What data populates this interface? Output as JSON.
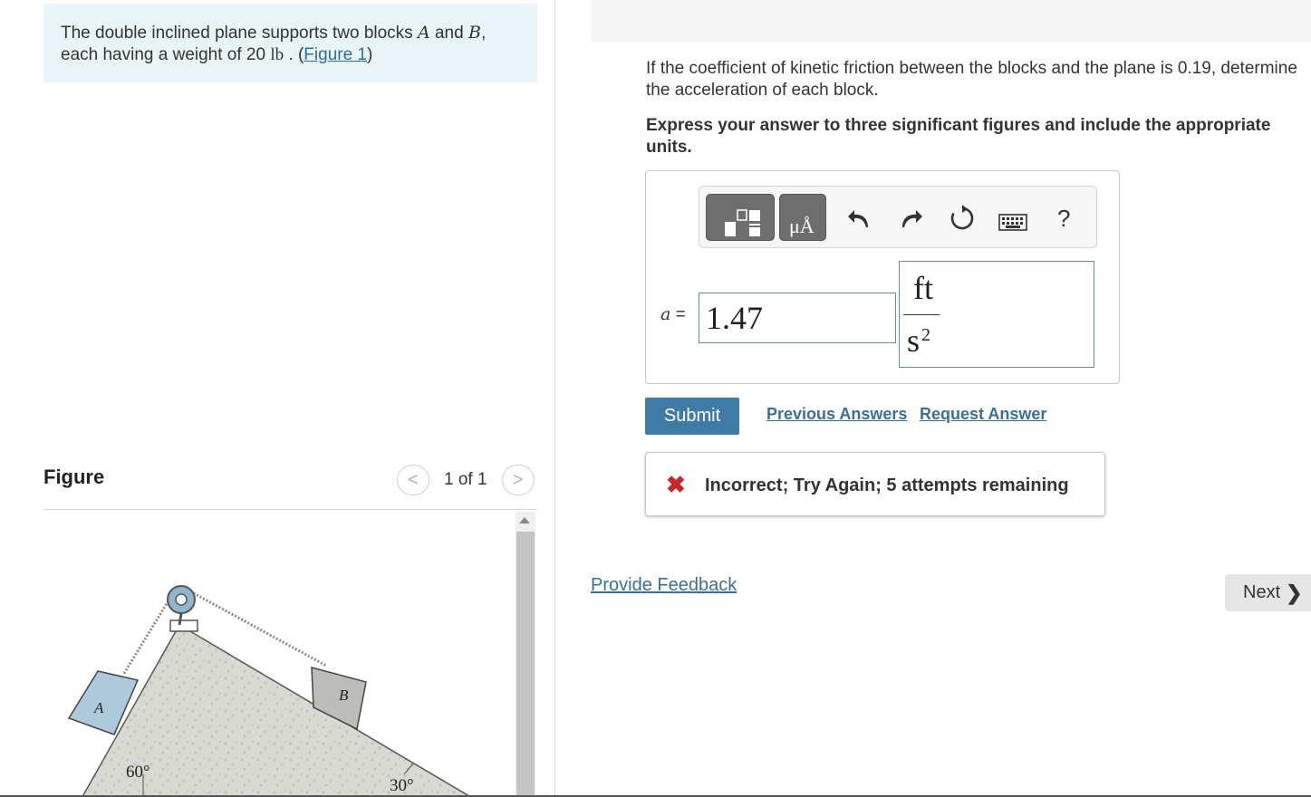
{
  "problem": {
    "text_before": "The double inclined plane supports two blocks ",
    "var_a": "A",
    "text_and": " and ",
    "var_b": "B",
    "text_comma": ",",
    "text_line2": "each having a weight of 20 ",
    "unit_lb": "lb",
    "text_dot": " . (",
    "figure_link": "Figure 1",
    "text_close": ")"
  },
  "figure": {
    "title": "Figure",
    "counter": "1 of 1",
    "prev_glyph": "<",
    "next_glyph": ">",
    "block_a": "A",
    "block_b": "B",
    "angle_left": "60°",
    "angle_right": "30°"
  },
  "part": {
    "question_line1": "If the coefficient of kinetic friction between the blocks and the plane is 0.19, determine",
    "question_line2": "the acceleration of each block.",
    "instruction": "Express your answer to three significant figures and include the appropriate units."
  },
  "toolbar": {
    "units_glyph": "μÅ",
    "help_glyph": "?"
  },
  "answer": {
    "label_var": "a",
    "label_eq": " =",
    "value": "1.47",
    "unit_numerator": "ft",
    "unit_denominator": "s",
    "unit_exponent": "2"
  },
  "actions": {
    "submit": "Submit",
    "previous_answers": "Previous Answers",
    "request_answer": "Request Answer"
  },
  "feedback": {
    "icon_glyph": "✖",
    "message": "Incorrect; Try Again; 5 attempts remaining"
  },
  "footer": {
    "provide_feedback": "Provide Feedback",
    "next": "Next",
    "next_glyph": "❯"
  },
  "colors": {
    "submit_bg": "#3f7ba5",
    "error": "#c62828",
    "link": "#3a6f9a",
    "problem_bg": "#e8f4f6"
  }
}
